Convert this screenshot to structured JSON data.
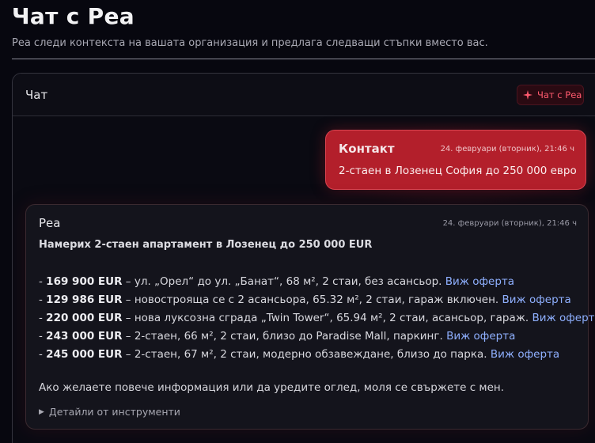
{
  "page": {
    "title": "Чат с Реа",
    "subtitle": "Реа следи контекста на вашата организация и предлага следващи стъпки вместо вас."
  },
  "chat": {
    "header_title": "Чат",
    "badge_label": "Чат с Реа",
    "contact_message": {
      "sender": "Контакт",
      "timestamp": "24. февруари (вторник), 21:46 ч",
      "text": "2-стаен в Лозенец София до 250 000 евро"
    },
    "rea_message": {
      "sender": "Реа",
      "timestamp": "24. февруари (вторник), 21:46 ч",
      "heading": "Намерих 2-стаен апартамент в Лозенец до 250 000 EUR",
      "offers": [
        {
          "prefix": "- ",
          "price": "169 900 EUR",
          "description": " – ул. „Орел“ до ул. „Банат“, 68 м², 2 стаи, без асансьор. ",
          "link": "Виж оферта"
        },
        {
          "prefix": "- ",
          "price": "129 986 EUR",
          "description": " – новостроящa се с 2 асансьора, 65.32 м², 2 стаи, гараж включен. ",
          "link": "Виж оферта"
        },
        {
          "prefix": "- ",
          "price": "220 000 EUR",
          "description": " – нова луксозна сграда „Twin Tower“, 65.94 м², 2 стаи, асансьор, гараж. ",
          "link": "Виж оферта"
        },
        {
          "prefix": "- ",
          "price": "243 000 EUR",
          "description": " – 2-стаен, 66 м², 2 стаи, близо до Paradise Mall, паркинг. ",
          "link": "Виж оферта"
        },
        {
          "prefix": "- ",
          "price": "245 000 EUR",
          "description": " – 2-стаен, 67 м², 2 стаи, модерно обзавеждане, близо до парка. ",
          "link": "Виж оферта"
        }
      ],
      "closing": "Ако желаете повече информация или да уредите оглед, моля се свържете с мен.",
      "tool_details_label": "Детайли от инструменти"
    }
  },
  "colors": {
    "accent": "#b31f2b",
    "badge_text": "#ff5a6e",
    "link": "#8fb0ff",
    "background": "#07070f"
  },
  "icons": {
    "badge_icon": "sparkle-icon",
    "details_icon": "triangle-right-icon"
  }
}
